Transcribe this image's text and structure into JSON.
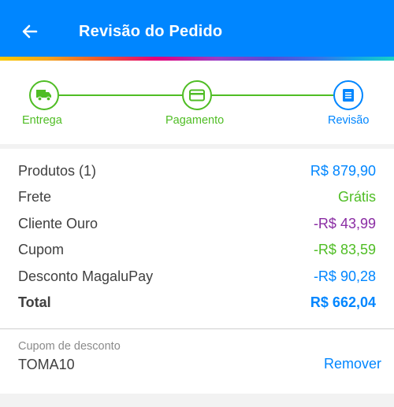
{
  "header": {
    "title": "Revisão do Pedido",
    "back_icon": "arrow-left-icon",
    "background": "#0086ff"
  },
  "stepper": {
    "steps": [
      {
        "label": "Entrega",
        "icon": "truck-icon",
        "status": "done"
      },
      {
        "label": "Pagamento",
        "icon": "credit-card-icon",
        "status": "done"
      },
      {
        "label": "Revisão",
        "icon": "receipt-icon",
        "status": "active"
      }
    ],
    "done_color": "#4fbd24",
    "active_color": "#0086ff"
  },
  "summary": {
    "rows": [
      {
        "label": "Produtos (1)",
        "value": "R$ 879,90",
        "color": "#0086ff"
      },
      {
        "label": "Frete",
        "value": "Grátis",
        "color": "#4fbd24"
      },
      {
        "label": "Cliente Ouro",
        "value": "-R$ 43,99",
        "color": "#8a2ca3"
      },
      {
        "label": "Cupom",
        "value": "-R$ 83,59",
        "color": "#4fbd24"
      },
      {
        "label": "Desconto MagaluPay",
        "value": "-R$ 90,28",
        "color": "#0086ff"
      }
    ],
    "total": {
      "label": "Total",
      "value": "R$ 662,04"
    }
  },
  "coupon": {
    "caption": "Cupom de desconto",
    "code": "TOMA10",
    "remove_label": "Remover"
  }
}
